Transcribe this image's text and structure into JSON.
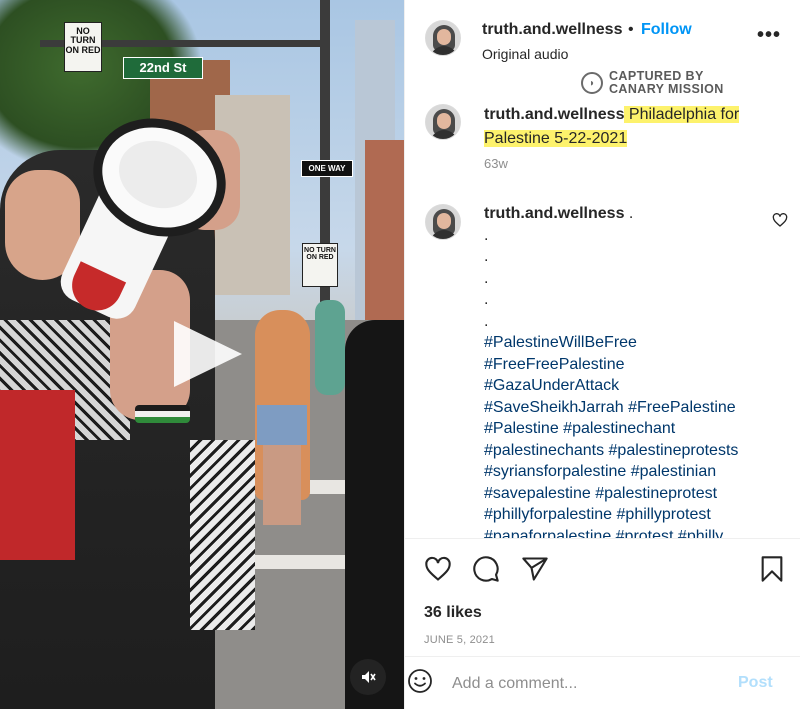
{
  "media": {
    "signs": {
      "no_turn_top": "NO TURN ON RED",
      "street": "22nd St",
      "one_way": "ONE WAY",
      "no_turn_lower": "NO TURN ON RED"
    },
    "play_icon": "play-icon",
    "mute_icon": "muted-speaker-icon"
  },
  "header": {
    "username": "truth.and.wellness",
    "separator": "•",
    "follow_label": "Follow",
    "more_label": "•••",
    "audio_label": "Original audio"
  },
  "watermark": {
    "line1": "CAPTURED BY",
    "line2": "CANARY MISSION"
  },
  "caption": {
    "username": "truth.and.wellness",
    "text_line1": "Philadelphia for",
    "text_line2": "Palestine 5-22-2021",
    "highlight_color": "#fdf26c",
    "time_ago": "63w"
  },
  "comment": {
    "username": "truth.and.wellness",
    "first_dot": ".",
    "dots": [
      ".",
      ".",
      ".",
      ".",
      "."
    ],
    "hashtag_lines": [
      "#PalestineWillBeFree",
      "#FreeFreePalestine",
      "#GazaUnderAttack",
      "#SaveSheikhJarrah #FreePalestine",
      "#Palestine #palestinechant",
      "#palestinechants #palestineprotests",
      "#syriansforpalestine #palestinian",
      "#savepalestine #palestineprotest",
      "#phillyforpalestine #phillyprotest",
      "#papaforpalestine #protest #philly"
    ],
    "link_color": "#00376b"
  },
  "actions": {
    "icons": [
      "heart-icon",
      "comment-icon",
      "share-icon",
      "bookmark-icon"
    ]
  },
  "likes": "36 likes",
  "date": "JUNE 5, 2021",
  "add_comment": {
    "placeholder": "Add a comment...",
    "value": "",
    "post_label": "Post",
    "emoji_icon": "emoji-icon"
  },
  "colors": {
    "accent": "#0095f6",
    "post_disabled": "#b2dffc",
    "muted_text": "#8e8e8e"
  }
}
